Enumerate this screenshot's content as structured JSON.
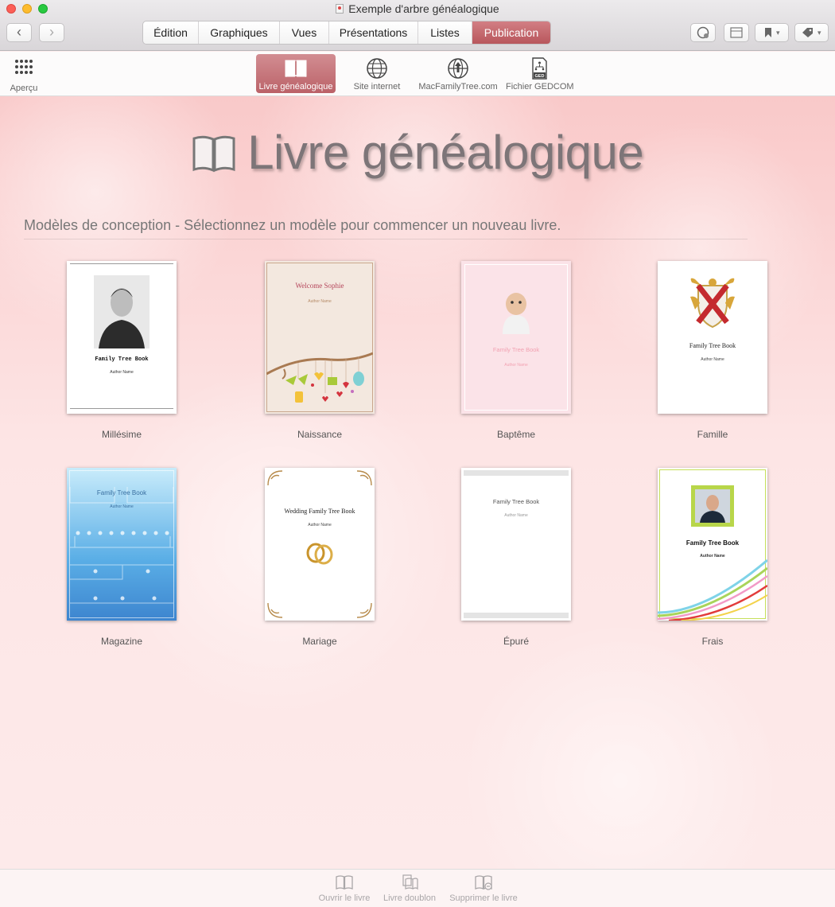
{
  "window": {
    "title": "Exemple d'arbre généalogique"
  },
  "main_tabs": [
    {
      "label": "Édition",
      "active": false
    },
    {
      "label": "Graphiques",
      "active": false
    },
    {
      "label": "Vues",
      "active": false
    },
    {
      "label": "Présentations",
      "active": false
    },
    {
      "label": "Listes",
      "active": false
    },
    {
      "label": "Publication",
      "active": true
    }
  ],
  "subtoolbar": {
    "overview_label": "Aperçu",
    "publish_tabs": [
      {
        "label": "Livre généalogique",
        "icon": "book-icon",
        "active": true
      },
      {
        "label": "Site internet",
        "icon": "globe-icon",
        "active": false
      },
      {
        "label": "MacFamilyTree.com",
        "icon": "globe-upload-icon",
        "active": false
      },
      {
        "label": "Fichier GEDCOM",
        "icon": "gedcom-file-icon",
        "active": false
      }
    ]
  },
  "page": {
    "title": "Livre généalogique",
    "subtitle": "Modèles de conception - Sélectionnez un modèle pour commencer un nouveau livre."
  },
  "templates": [
    {
      "label": "Millésime",
      "cover_title": "Family Tree Book",
      "cover_author": "Author Name"
    },
    {
      "label": "Naissance",
      "cover_title": "Welcome Sophie",
      "cover_author": "Author Name"
    },
    {
      "label": "Baptême",
      "cover_title": "Family Tree Book",
      "cover_author": "Author Name"
    },
    {
      "label": "Famille",
      "cover_title": "Family Tree Book",
      "cover_author": "Author Name"
    },
    {
      "label": "Magazine",
      "cover_title": "Family Tree Book",
      "cover_author": "Author Name"
    },
    {
      "label": "Mariage",
      "cover_title": "Wedding Family Tree Book",
      "cover_author": "Author Name"
    },
    {
      "label": "Épuré",
      "cover_title": "Family Tree Book",
      "cover_author": "Author Name"
    },
    {
      "label": "Frais",
      "cover_title": "Family Tree Book",
      "cover_author": "Author Name"
    }
  ],
  "bottom_actions": [
    {
      "label": "Ouvrir le livre",
      "icon": "open-book-icon"
    },
    {
      "label": "Livre doublon",
      "icon": "duplicate-book-icon"
    },
    {
      "label": "Supprimer le livre",
      "icon": "delete-book-icon"
    }
  ],
  "colors": {
    "accent": "#c0636a",
    "background": "#fde8e8"
  }
}
